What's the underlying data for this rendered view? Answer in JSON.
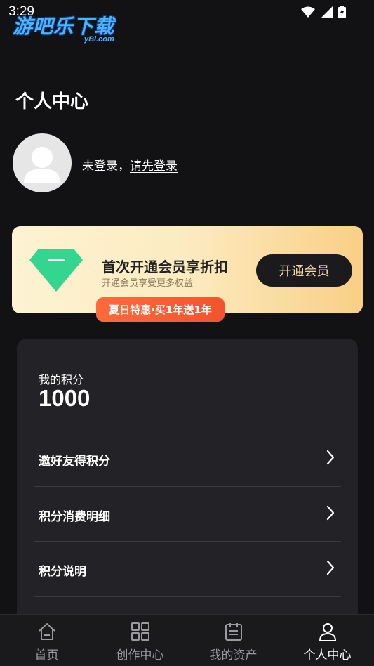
{
  "status_bar": {
    "time": "3:29"
  },
  "watermark": {
    "main": "游吧乐下载",
    "sub": "yBl.com"
  },
  "page": {
    "title": "个人中心"
  },
  "user": {
    "status": "未登录，",
    "login_link": "请先登录"
  },
  "vip": {
    "title": "首次开通会员享折扣",
    "subtitle": "开通会员享受更多权益",
    "button": "开通会员",
    "promo": "夏日特惠·买1年送1年",
    "colors": {
      "gem": "#34d58f",
      "promo": "#f2542d"
    }
  },
  "points": {
    "label": "我的积分",
    "value": "1000",
    "rows": [
      {
        "label": "邀好友得积分"
      },
      {
        "label": "积分消费明细"
      },
      {
        "label": "积分说明"
      }
    ]
  },
  "tabbar": {
    "tabs": [
      {
        "label": "首页",
        "icon": "home-icon",
        "active": false
      },
      {
        "label": "创作中心",
        "icon": "grid-icon",
        "active": false
      },
      {
        "label": "我的资产",
        "icon": "document-icon",
        "active": false
      },
      {
        "label": "个人中心",
        "icon": "person-icon",
        "active": true
      }
    ]
  }
}
